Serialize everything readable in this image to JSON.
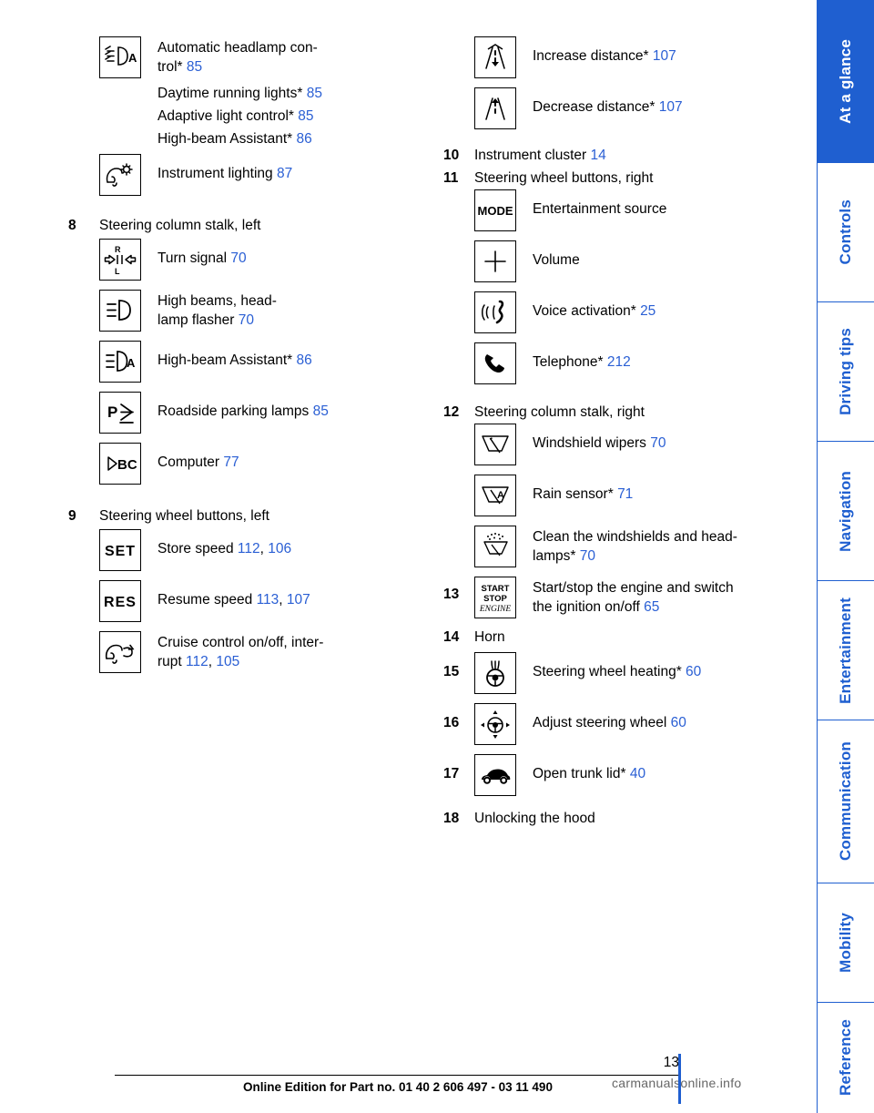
{
  "page": {
    "number": "13",
    "footer": "Online Edition for Part no. 01 40 2 606 497 - 03 11 490",
    "watermark": "carmanualsonline.info"
  },
  "tabs": [
    {
      "label": "At a glance",
      "style": "filled"
    },
    {
      "label": "Controls",
      "style": "light"
    },
    {
      "label": "Driving tips",
      "style": "light"
    },
    {
      "label": "Navigation",
      "style": "light"
    },
    {
      "label": "Entertainment",
      "style": "light"
    },
    {
      "label": "Communication",
      "style": "light"
    },
    {
      "label": "Mobility",
      "style": "light"
    },
    {
      "label": "Reference",
      "style": "light"
    }
  ],
  "left_column": {
    "group_headlamp": {
      "icon": "automatic-headlamp-control-icon",
      "lines": [
        {
          "text": "Automatic headlamp con-",
          "page": ""
        },
        {
          "text": "trol*",
          "page": "85"
        },
        {
          "text": "Daytime running lights*",
          "page": "85"
        },
        {
          "text": "Adaptive light control*",
          "page": "85"
        },
        {
          "text": "High-beam Assistant*",
          "page": "86"
        }
      ]
    },
    "instrument_lighting": {
      "icon": "instrument-lighting-icon",
      "text": "Instrument lighting",
      "page": "87"
    },
    "item8": {
      "number": "8",
      "title": "Steering column stalk, left",
      "entries": [
        {
          "icon": "turn-signal-icon",
          "text": "Turn signal",
          "page": "70"
        },
        {
          "icon": "high-beams-headlamp-flasher-icon",
          "text_line1": "High beams, head-",
          "text_line2": "lamp flasher",
          "page": "70"
        },
        {
          "icon": "high-beam-assistant-icon",
          "text": "High-beam Assistant*",
          "page": "86"
        },
        {
          "icon": "roadside-parking-lamps-icon",
          "text": "Roadside parking lamps",
          "page": "85"
        },
        {
          "icon": "computer-icon",
          "text": "Computer",
          "page": "77"
        }
      ]
    },
    "item9": {
      "number": "9",
      "title": "Steering wheel buttons, left",
      "entries": [
        {
          "icon": "set-button-icon",
          "text": "Store speed",
          "pages": [
            "112",
            "106"
          ]
        },
        {
          "icon": "res-button-icon",
          "text": "Resume speed",
          "pages": [
            "113",
            "107"
          ]
        },
        {
          "icon": "cruise-control-icon",
          "text_line1": "Cruise control on/off, inter-",
          "text_line2": "rupt",
          "pages": [
            "112",
            "105"
          ]
        }
      ]
    }
  },
  "right_column": {
    "distance_group": [
      {
        "icon": "increase-distance-icon",
        "text": "Increase distance*",
        "page": "107"
      },
      {
        "icon": "decrease-distance-icon",
        "text": "Decrease distance*",
        "page": "107"
      }
    ],
    "item10": {
      "number": "10",
      "title": "Instrument cluster",
      "page": "14"
    },
    "item11": {
      "number": "11",
      "title": "Steering wheel buttons, right",
      "entries": [
        {
          "icon": "mode-button-icon",
          "text": "Entertainment source",
          "page": ""
        },
        {
          "icon": "volume-button-icon",
          "text": "Volume",
          "page": ""
        },
        {
          "icon": "voice-activation-icon",
          "text": "Voice activation*",
          "page": "25"
        },
        {
          "icon": "telephone-icon",
          "text": "Telephone*",
          "page": "212"
        }
      ]
    },
    "item12": {
      "number": "12",
      "title": "Steering column stalk, right",
      "entries": [
        {
          "icon": "windshield-wipers-icon",
          "text": "Windshield wipers",
          "page": "70"
        },
        {
          "icon": "rain-sensor-icon",
          "text": "Rain sensor*",
          "page": "71"
        },
        {
          "icon": "clean-windshields-headlamps-icon",
          "text_line1": "Clean the windshields and head-",
          "text_line2": "lamps*",
          "page": "70"
        }
      ]
    },
    "item13": {
      "number": "13",
      "icon": "start-stop-engine-icon",
      "text_line1": "Start/stop the engine and switch",
      "text_line2": "the ignition on/off",
      "page": "65"
    },
    "item14": {
      "number": "14",
      "title": "Horn"
    },
    "item15": {
      "number": "15",
      "icon": "steering-wheel-heating-icon",
      "text": "Steering wheel heating*",
      "page": "60"
    },
    "item16": {
      "number": "16",
      "icon": "adjust-steering-wheel-icon",
      "text": "Adjust steering wheel",
      "page": "60"
    },
    "item17": {
      "number": "17",
      "icon": "open-trunk-lid-icon",
      "text": "Open trunk lid*",
      "page": "40"
    },
    "item18": {
      "number": "18",
      "title": "Unlocking the hood"
    }
  }
}
